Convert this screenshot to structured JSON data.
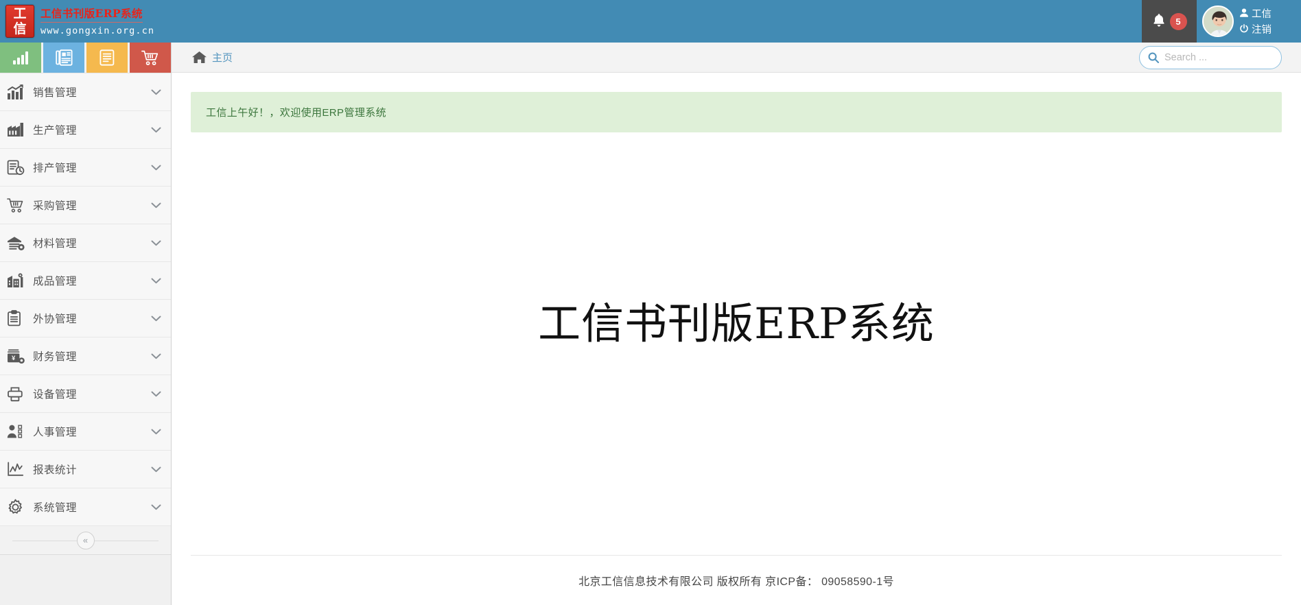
{
  "header": {
    "logo_char_top": "工",
    "logo_char_bottom": "信",
    "brand_title": "工信书刊版ERP系统",
    "brand_url": "www.gongxin.org.cn",
    "notification_count": "5",
    "user_name": "工信",
    "logout_label": "注销"
  },
  "quick_buttons": [
    {
      "name": "chart-button",
      "icon": "bar-chart-icon",
      "color": "#7fbf7f"
    },
    {
      "name": "news-button",
      "icon": "newspaper-icon",
      "color": "#6cb2e0"
    },
    {
      "name": "document-button",
      "icon": "document-icon",
      "color": "#f5b94e"
    },
    {
      "name": "cart-button",
      "icon": "shopping-cart-icon",
      "color": "#d0584a"
    }
  ],
  "sidebar": {
    "items": [
      {
        "label": "销售管理",
        "icon": "sales-chart-icon"
      },
      {
        "label": "生产管理",
        "icon": "factory-icon"
      },
      {
        "label": "排产管理",
        "icon": "schedule-clock-icon"
      },
      {
        "label": "采购管理",
        "icon": "purchase-cart-icon"
      },
      {
        "label": "材料管理",
        "icon": "warehouse-gear-icon"
      },
      {
        "label": "成品管理",
        "icon": "finished-goods-icon"
      },
      {
        "label": "外协管理",
        "icon": "clipboard-icon"
      },
      {
        "label": "财务管理",
        "icon": "finance-yuan-icon"
      },
      {
        "label": "设备管理",
        "icon": "printer-icon"
      },
      {
        "label": "人事管理",
        "icon": "personnel-icon"
      },
      {
        "label": "报表统计",
        "icon": "report-chart-icon"
      },
      {
        "label": "系统管理",
        "icon": "gear-icon"
      }
    ],
    "collapse_glyph": "«"
  },
  "breadcrumb": {
    "home_label": "主页"
  },
  "search": {
    "placeholder": "Search ...",
    "value": ""
  },
  "main": {
    "welcome_alert": "工信上午好！，欢迎使用ERP管理系统",
    "hero_title": "工信书刊版ERP系统"
  },
  "footer": {
    "text": "北京工信信息技术有限公司 版权所有 京ICP备： 09058590-1号"
  },
  "colors": {
    "header_blue": "#428bb4",
    "notif_dark": "#4b4b4b",
    "badge_red": "#d9534f",
    "logo_red": "#e23b2e",
    "alert_bg": "#dff0d8",
    "alert_text": "#3c763d",
    "link_blue": "#5596bf"
  },
  "chevron_glyph": "⌄"
}
